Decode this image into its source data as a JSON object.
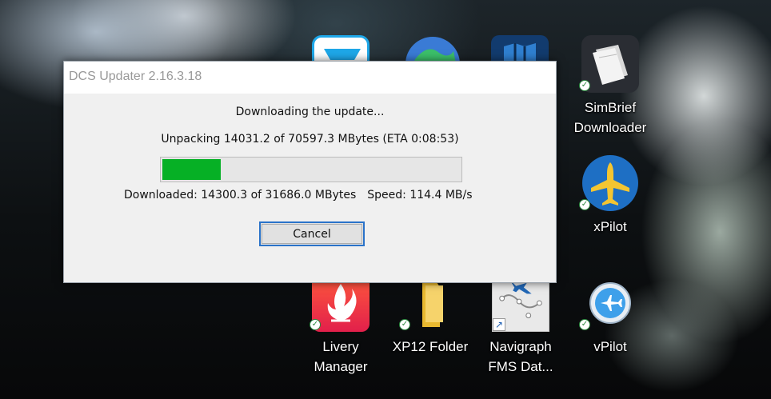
{
  "dialog": {
    "title": "DCS Updater 2.16.3.18",
    "status": "Downloading the update...",
    "unpacking": "Unpacking 14031.2 of 70597.3 MBytes (ETA 0:08:53)",
    "progress_fraction": 0.195,
    "downloaded": "Downloaded: 14300.3 of 31686.0 MBytes",
    "speed": "Speed: 114.4 MB/s",
    "cancel_label": "Cancel"
  },
  "desktop": {
    "shortcuts": [
      {
        "label_line1": "SimBrief",
        "label_line2": "Downloader",
        "icon": "simbrief-icon"
      },
      {
        "label_line1": "xPilot",
        "label_line2": "",
        "icon": "xpilot-icon"
      },
      {
        "label_line1": "Livery",
        "label_line2": "Manager",
        "icon": "livery-manager-icon"
      },
      {
        "label_line1": "XP12 Folder",
        "label_line2": "",
        "icon": "folder-icon"
      },
      {
        "label_line1": "Navigraph",
        "label_line2": "FMS Dat...",
        "icon": "navigraph-fms-icon"
      },
      {
        "label_line1": "vPilot",
        "label_line2": "",
        "icon": "vpilot-icon"
      }
    ],
    "colors": {
      "progress_fill": "#06b025",
      "focus_border": "#2a73c9"
    }
  }
}
